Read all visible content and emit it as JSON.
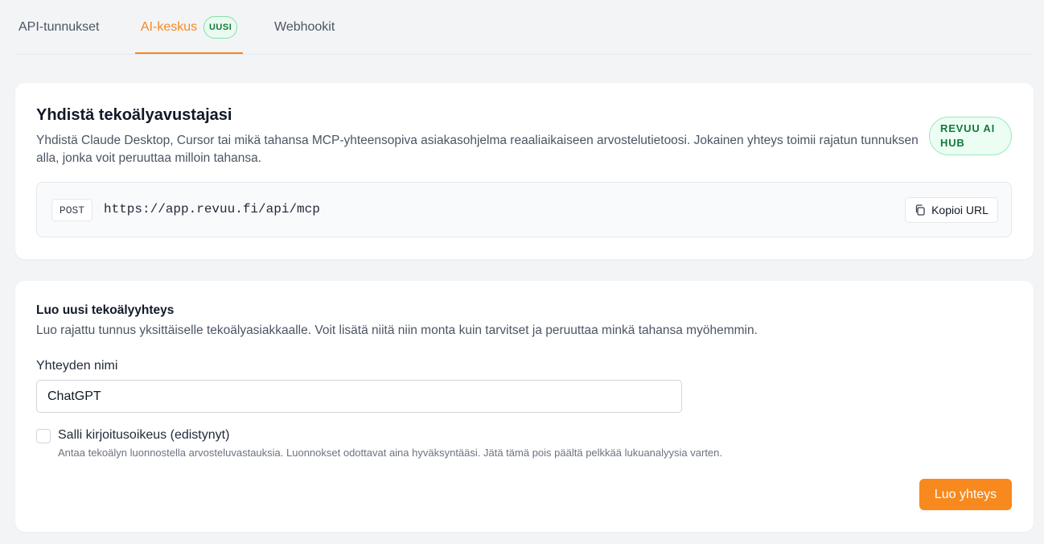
{
  "tabs": {
    "api_tokens": "API-tunnukset",
    "ai_hub": "AI-keskus",
    "ai_hub_badge": "UUSI",
    "webhooks": "Webhookit",
    "active": "AI-keskus"
  },
  "connect": {
    "title": "Yhdistä tekoälyavustajasi",
    "description": "Yhdistä Claude Desktop, Cursor tai mikä tahansa MCP-yhteensopiva asiakasohjelma reaaliaikaiseen arvostelutietoosi. Jokainen yhteys toimii rajatun tunnuksen alla, jonka voit peruuttaa milloin tahansa.",
    "badge": "REVUU AI HUB",
    "method": "POST",
    "url": "https://app.revuu.fi/api/mcp",
    "copy_label": "Kopioi URL"
  },
  "create": {
    "title": "Luo uusi tekoälyyhteys",
    "description": "Luo rajattu tunnus yksittäiselle tekoälyasiakkaalle. Voit lisätä niitä niin monta kuin tarvitset ja peruuttaa minkä tahansa myöhemmin.",
    "name_label": "Yhteyden nimi",
    "name_value": "ChatGPT",
    "write_label": "Salli kirjoitusoikeus (edistynyt)",
    "write_checked": false,
    "write_help": "Antaa tekoälyn luonnostella arvosteluvastauksia. Luonnokset odottavat aina hyväksyntääsi. Jätä tämä pois päältä pelkkää lukuanalyysia varten.",
    "submit_label": "Luo yhteys"
  },
  "colors": {
    "accent": "#f7891f",
    "badge_green": "#127a3c",
    "background": "#f3f4f6"
  },
  "icons": {
    "copy": "copy-icon"
  }
}
